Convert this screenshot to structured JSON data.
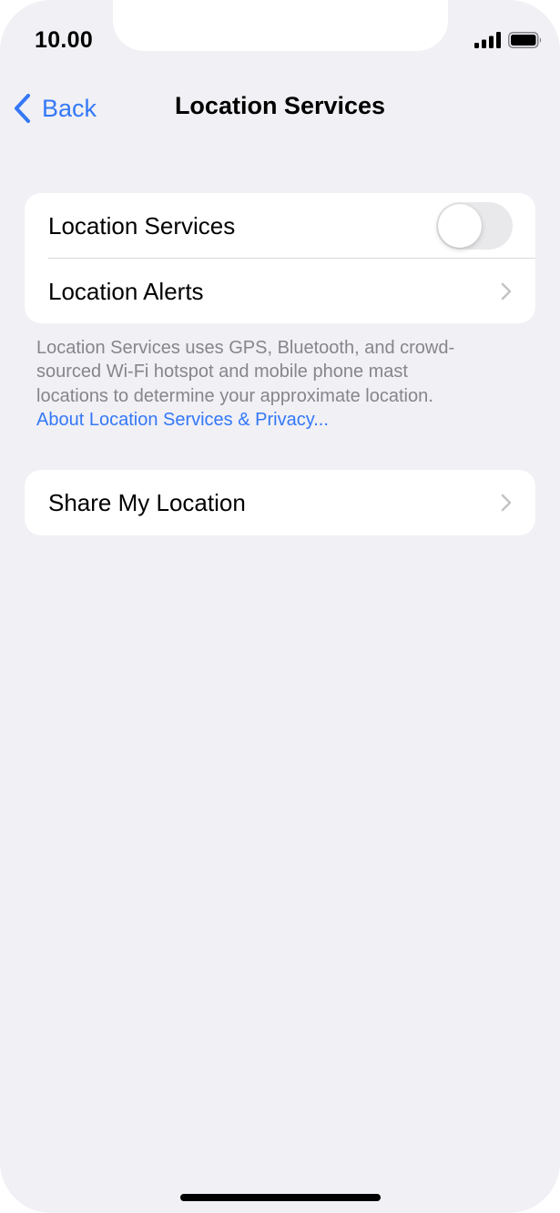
{
  "status_bar": {
    "time": "10.00",
    "signal_icon": "cellular-signal-icon",
    "battery_icon": "battery-full-icon"
  },
  "nav": {
    "back_label": "Back",
    "back_icon": "chevron-left-icon",
    "title": "Location Services"
  },
  "groups": [
    {
      "rows": [
        {
          "label": "Location Services",
          "control": "toggle",
          "toggle_on": false
        },
        {
          "label": "Location Alerts",
          "control": "chevron"
        }
      ],
      "footer": {
        "line1": "Location Services uses GPS, Bluetooth, and crowd-",
        "line2": "sourced Wi-Fi hotspot and mobile phone mast",
        "line3": "locations to determine your approximate location.",
        "link": "About Location Services & Privacy..."
      }
    },
    {
      "rows": [
        {
          "label": "Share My Location",
          "control": "chevron"
        }
      ]
    }
  ],
  "colors": {
    "accent": "#3478f6",
    "background": "#f0f0f5",
    "cell": "#ffffff",
    "footer_text": "#85858b",
    "toggle_off": "#e9e9eb"
  }
}
